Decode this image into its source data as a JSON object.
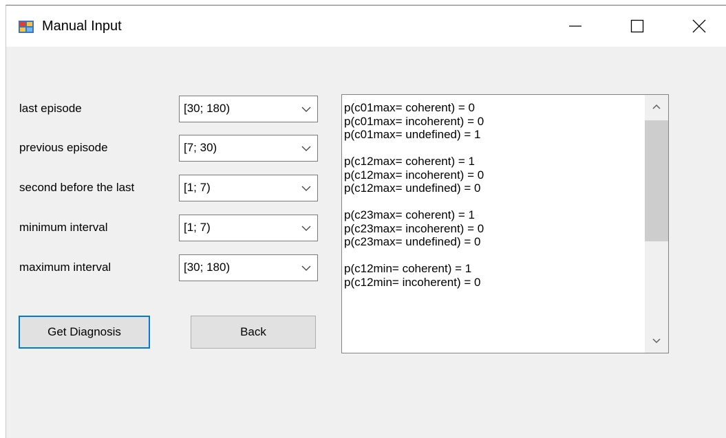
{
  "window": {
    "title": "Manual Input",
    "app_icon": "windows-form-icon",
    "controls": {
      "minimize_icon": "minimize-icon",
      "maximize_icon": "maximize-icon",
      "close_icon": "close-icon"
    }
  },
  "fields": [
    {
      "label": "last episode",
      "value": "[30; 180)"
    },
    {
      "label": "previous episode",
      "value": "[7; 30)"
    },
    {
      "label": "second before the last",
      "value": "[1; 7)"
    },
    {
      "label": "minimum interval",
      "value": "[1; 7)"
    },
    {
      "label": "maximum interval",
      "value": "[30; 180)"
    }
  ],
  "buttons": {
    "diagnosis_label": "Get Diagnosis",
    "back_label": "Back"
  },
  "results": {
    "lines": [
      "p(c01max= coherent) = 0",
      "p(c01max= incoherent) = 0",
      "p(c01max= undefined) = 1",
      "",
      "p(c12max= coherent) = 1",
      "p(c12max= incoherent) = 0",
      "p(c12max= undefined) = 0",
      "",
      "p(c23max= coherent) = 1",
      "p(c23max= incoherent) = 0",
      "p(c23max= undefined) = 0",
      "",
      "p(c12min= coherent) = 1",
      "p(c12min= incoherent) = 0"
    ],
    "scroll_position": 0.0
  },
  "colors": {
    "window_bg": "#f0f0f0",
    "accent_focus": "#0078d7",
    "button_bg": "#e1e1e1"
  }
}
